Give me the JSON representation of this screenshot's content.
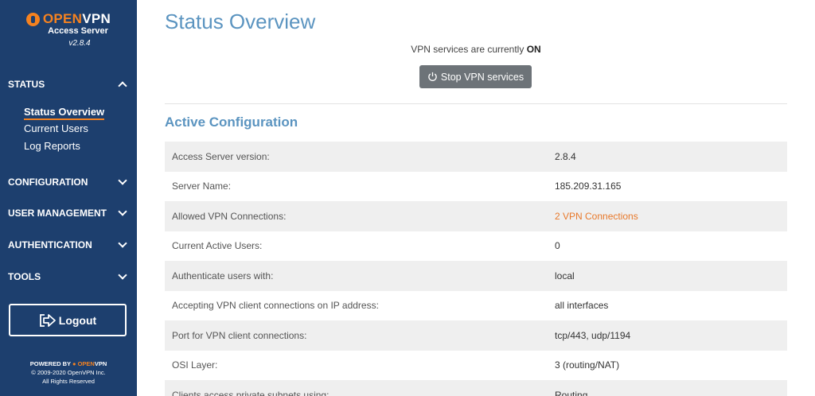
{
  "brand": {
    "logo_open": "OPEN",
    "logo_vpn": "VPN",
    "subtitle": "Access Server",
    "version": "v2.8.4"
  },
  "sidebar": {
    "sections": [
      {
        "label": "STATUS",
        "expanded": true
      },
      {
        "label": "CONFIGURATION",
        "expanded": false
      },
      {
        "label": "USER MANAGEMENT",
        "expanded": false
      },
      {
        "label": "AUTHENTICATION",
        "expanded": false
      },
      {
        "label": "TOOLS",
        "expanded": false
      }
    ],
    "status_items": [
      {
        "label": "Status Overview",
        "active": true
      },
      {
        "label": "Current Users",
        "active": false
      },
      {
        "label": "Log Reports",
        "active": false
      }
    ],
    "logout_label": "Logout",
    "logout_icon": "logout-icon"
  },
  "footer": {
    "powered_by": "POWERED BY",
    "powered_open": "OPEN",
    "powered_vpn": "VPN",
    "copyright": "© 2009-2020 OpenVPN Inc.",
    "rights": "All Rights Reserved"
  },
  "main": {
    "title": "Status Overview",
    "status_prefix": "VPN services are currently",
    "status_value": "ON",
    "stop_button": "Stop VPN services",
    "stop_icon": "power-icon",
    "section_title": "Active Configuration",
    "config": [
      {
        "key": "Access Server version:",
        "value": "2.8.4"
      },
      {
        "key": "Server Name:",
        "value": "185.209.31.165"
      },
      {
        "key": "Allowed VPN Connections:",
        "value": "2 VPN Connections",
        "link": true
      },
      {
        "key": "Current Active Users:",
        "value": "0"
      },
      {
        "key": "Authenticate users with:",
        "value": "local"
      },
      {
        "key": "Accepting VPN client connections on IP address:",
        "value": "all interfaces"
      },
      {
        "key": "Port for VPN client connections:",
        "value": "tcp/443, udp/1194"
      },
      {
        "key": "OSI Layer:",
        "value": "3 (routing/NAT)"
      },
      {
        "key": "Clients access private subnets using:",
        "value": "Routing"
      }
    ]
  },
  "colors": {
    "sidebar_bg": "#1d3f6e",
    "accent_orange": "#f58220",
    "title_blue": "#5b94c0",
    "button_gray": "#6d7378"
  }
}
